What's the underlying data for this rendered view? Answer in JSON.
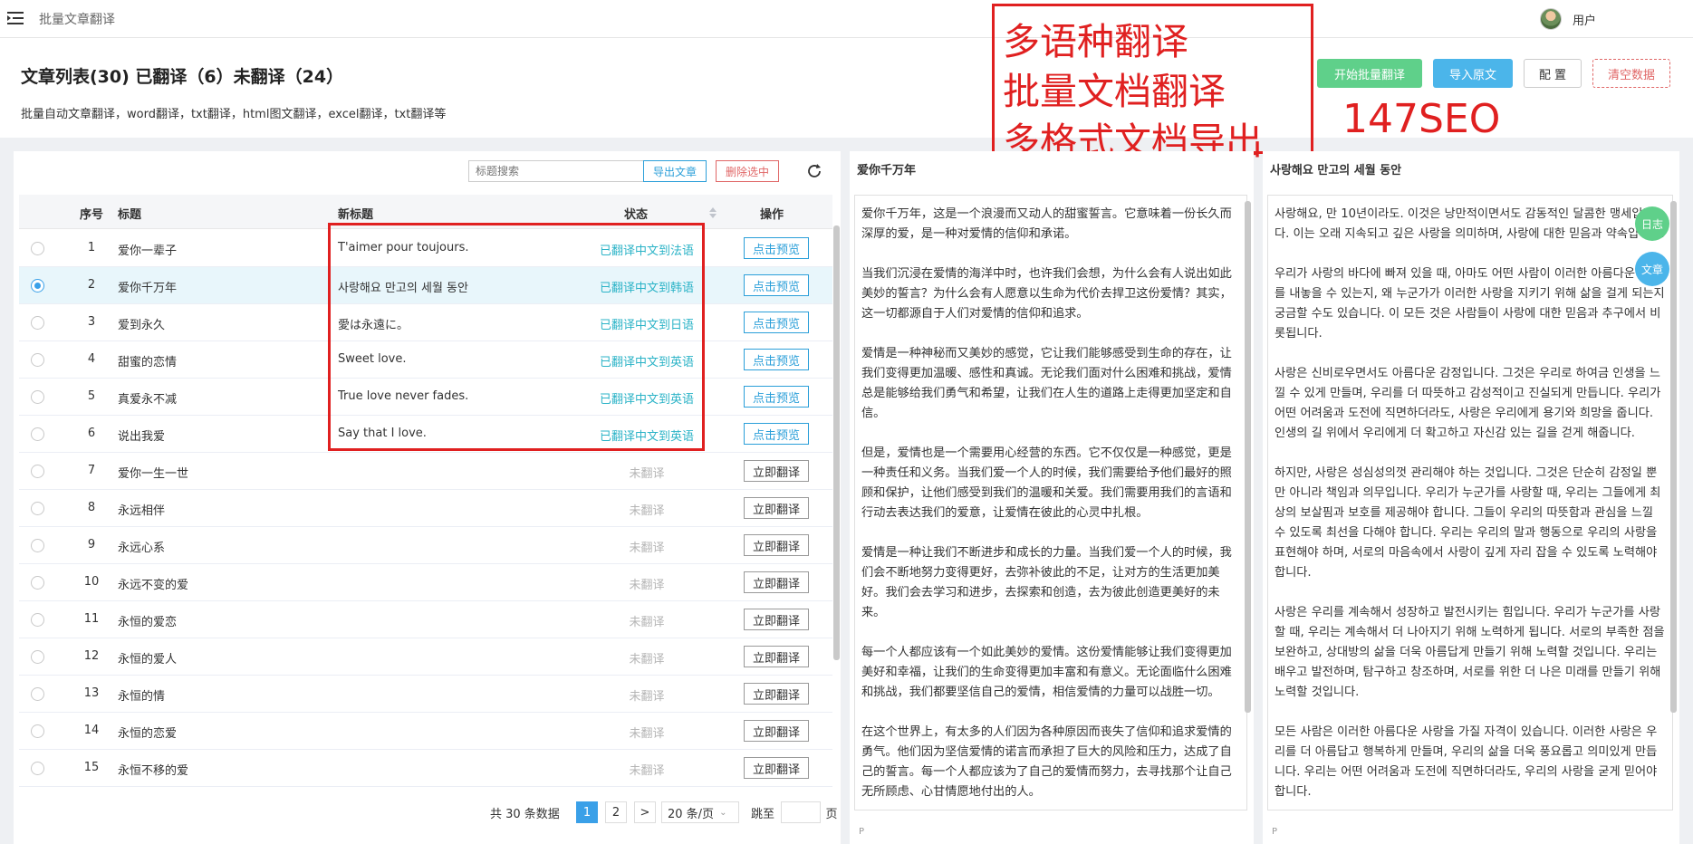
{
  "app": {
    "title": "批量文章翻译",
    "user_name": "用户"
  },
  "header": {
    "title": "文章列表(30) 已翻译（6）未翻译（24）",
    "subtitle": "批量自动文章翻译，word翻译，txt翻译，html图文翻译，excel翻译，txt翻译等",
    "buttons": {
      "batch": "开始批量翻译",
      "import": "导入原文",
      "config": "配 置",
      "clear": "清空数据"
    }
  },
  "annotation": {
    "lines": [
      "多语种翻译",
      "批量文档翻译",
      "多格式文档导出"
    ],
    "brand": "147SEO"
  },
  "toolbar": {
    "search_placeholder": "标题搜索",
    "export": "导出文章",
    "delete": "删除选中"
  },
  "table": {
    "headers": {
      "index": "序号",
      "title": "标题",
      "new_title": "新标题",
      "status": "状态",
      "op": "操作"
    },
    "rows": [
      {
        "index": "1",
        "title": "爱你一辈子",
        "new_title": "T'aimer pour toujours.",
        "status": "已翻译中文到法语",
        "op": "点击预览",
        "done": true,
        "selected": false
      },
      {
        "index": "2",
        "title": "爱你千万年",
        "new_title": "사랑해요 만고의 세월 동안",
        "status": "已翻译中文到韩语",
        "op": "点击预览",
        "done": true,
        "selected": true
      },
      {
        "index": "3",
        "title": "爱到永久",
        "new_title": "愛は永遠に。",
        "status": "已翻译中文到日语",
        "op": "点击预览",
        "done": true,
        "selected": false
      },
      {
        "index": "4",
        "title": "甜蜜的恋情",
        "new_title": "Sweet love.",
        "status": "已翻译中文到英语",
        "op": "点击预览",
        "done": true,
        "selected": false
      },
      {
        "index": "5",
        "title": "真爱永不减",
        "new_title": "True love never fades.",
        "status": "已翻译中文到英语",
        "op": "点击预览",
        "done": true,
        "selected": false
      },
      {
        "index": "6",
        "title": "说出我爱",
        "new_title": "Say that I love.",
        "status": "已翻译中文到英语",
        "op": "点击预览",
        "done": true,
        "selected": false
      },
      {
        "index": "7",
        "title": "爱你一生一世",
        "new_title": "",
        "status": "未翻译",
        "op": "立即翻译",
        "done": false,
        "selected": false
      },
      {
        "index": "8",
        "title": "永远相伴",
        "new_title": "",
        "status": "未翻译",
        "op": "立即翻译",
        "done": false,
        "selected": false
      },
      {
        "index": "9",
        "title": "永远心系",
        "new_title": "",
        "status": "未翻译",
        "op": "立即翻译",
        "done": false,
        "selected": false
      },
      {
        "index": "10",
        "title": "永远不变的爱",
        "new_title": "",
        "status": "未翻译",
        "op": "立即翻译",
        "done": false,
        "selected": false
      },
      {
        "index": "11",
        "title": "永恒的爱恋",
        "new_title": "",
        "status": "未翻译",
        "op": "立即翻译",
        "done": false,
        "selected": false
      },
      {
        "index": "12",
        "title": "永恒的爱人",
        "new_title": "",
        "status": "未翻译",
        "op": "立即翻译",
        "done": false,
        "selected": false
      },
      {
        "index": "13",
        "title": "永恒的情",
        "new_title": "",
        "status": "未翻译",
        "op": "立即翻译",
        "done": false,
        "selected": false
      },
      {
        "index": "14",
        "title": "永恒的恋爱",
        "new_title": "",
        "status": "未翻译",
        "op": "立即翻译",
        "done": false,
        "selected": false
      },
      {
        "index": "15",
        "title": "永恒不移的爱",
        "new_title": "",
        "status": "未翻译",
        "op": "立即翻译",
        "done": false,
        "selected": false
      }
    ]
  },
  "pagination": {
    "total": "共 30 条数据",
    "pages": [
      "1",
      "2"
    ],
    "next": ">",
    "size": "20 条/页",
    "jump": "跳至",
    "page_suffix": "页"
  },
  "source": {
    "title": "爱你千万年",
    "paragraphs": [
      "爱你千万年，这是一个浪漫而又动人的甜蜜誓言。它意味着一份长久而深厚的爱，是一种对爱情的信仰和承诺。",
      "当我们沉浸在爱情的海洋中时，也许我们会想，为什么会有人说出如此美妙的誓言？为什么会有人愿意以生命为代价去捍卫这份爱情？其实，这一切都源自于人们对爱情的信仰和追求。",
      "爱情是一种神秘而又美妙的感觉，它让我们能够感受到生命的存在，让我们变得更加温暖、感性和真诚。无论我们面对什么困难和挑战，爱情总是能够给我们勇气和希望，让我们在人生的道路上走得更加坚定和自信。",
      "但是，爱情也是一个需要用心经营的东西。它不仅仅是一种感觉，更是一种责任和义务。当我们爱一个人的时候，我们需要给予他们最好的照顾和保护，让他们感受到我们的温暖和关爱。我们需要用我们的言语和行动去表达我们的爱意，让爱情在彼此的心灵中扎根。",
      "爱情是一种让我们不断进步和成长的力量。当我们爱一个人的时候，我们会不断地努力变得更好，去弥补彼此的不足，让对方的生活更加美好。我们会去学习和进步，去探索和创造，去为彼此创造更美好的未来。",
      "每一个人都应该有一个如此美妙的爱情。这份爱情能够让我们变得更加美好和幸福，让我们的生命变得更加丰富和有意义。无论面临什么困难和挑战，我们都要坚信自己的爱情，相信爱情的力量可以战胜一切。",
      "在这个世界上，有太多的人们因为各种原因而丧失了信仰和追求爱情的勇气。他们因为坚信爱情的诺言而承担了巨大的风险和压力，达成了自己的誓言。每一个人都应该为了自己的爱情而努力，去寻找那个让自己无所顾虑、心甘情愿地付出的人。"
    ],
    "footer": "P"
  },
  "translation": {
    "title": "사랑해요 만고의 세월 동안",
    "paragraphs": [
      "사랑해요, 만 10년이라도. 이것은 낭만적이면서도 감동적인 달콤한 맹세입니다. 이는 오래 지속되고 깊은 사랑을 의미하며, 사랑에 대한 믿음과 약속입니다.",
      "우리가 사랑의 바다에 빠져 있을 때, 아마도 어떤 사람이 이러한 아름다운 맹세를 내놓을 수 있는지, 왜 누군가가 이러한 사랑을 지키기 위해 삶을 걸게 되는지 궁금할 수도 있습니다. 이 모든 것은 사람들이 사랑에 대한 믿음과 추구에서 비롯됩니다.",
      "사랑은 신비로우면서도 아름다운 감정입니다. 그것은 우리로 하여금 인생을 느낄 수 있게 만들며, 우리를 더 따뜻하고 감성적이고 진실되게 만듭니다. 우리가 어떤 어려움과 도전에 직면하더라도, 사랑은 우리에게 용기와 희망을 줍니다. 인생의 길 위에서 우리에게 더 확고하고 자신감 있는 길을 걷게 해줍니다.",
      "하지만, 사랑은 성심성의껏 관리해야 하는 것입니다. 그것은 단순히 감정일 뿐만 아니라 책임과 의무입니다. 우리가 누군가를 사랑할 때, 우리는 그들에게 최상의 보살핌과 보호를 제공해야 합니다. 그들이 우리의 따뜻함과 관심을 느낄 수 있도록 최선을 다해야 합니다. 우리는 우리의 말과 행동으로 우리의 사랑을 표현해야 하며, 서로의 마음속에서 사랑이 깊게 자리 잡을 수 있도록 노력해야 합니다.",
      "사랑은 우리를 계속해서 성장하고 발전시키는 힘입니다. 우리가 누군가를 사랑할 때, 우리는 계속해서 더 나아지기 위해 노력하게 됩니다. 서로의 부족한 점을 보완하고, 상대방의 삶을 더욱 아름답게 만들기 위해 노력할 것입니다. 우리는 배우고 발전하며, 탐구하고 창조하며, 서로를 위한 더 나은 미래를 만들기 위해 노력할 것입니다.",
      "모든 사람은 이러한 아름다운 사랑을 가질 자격이 있습니다. 이러한 사랑은 우리를 더 아름답고 행복하게 만들며, 우리의 삶을 더욱 풍요롭고 의미있게 만듭니다. 우리는 어떤 어려움과 도전에 직면하더라도, 우리의 사랑을 굳게 믿어야 합니다."
    ],
    "footer": "P"
  },
  "side_buttons": {
    "log": "日志",
    "article": "文章"
  },
  "colors": {
    "green": "#5fd08a",
    "blue": "#4bb5ea",
    "teal": "#2bb3c7",
    "red": "#e02020"
  }
}
